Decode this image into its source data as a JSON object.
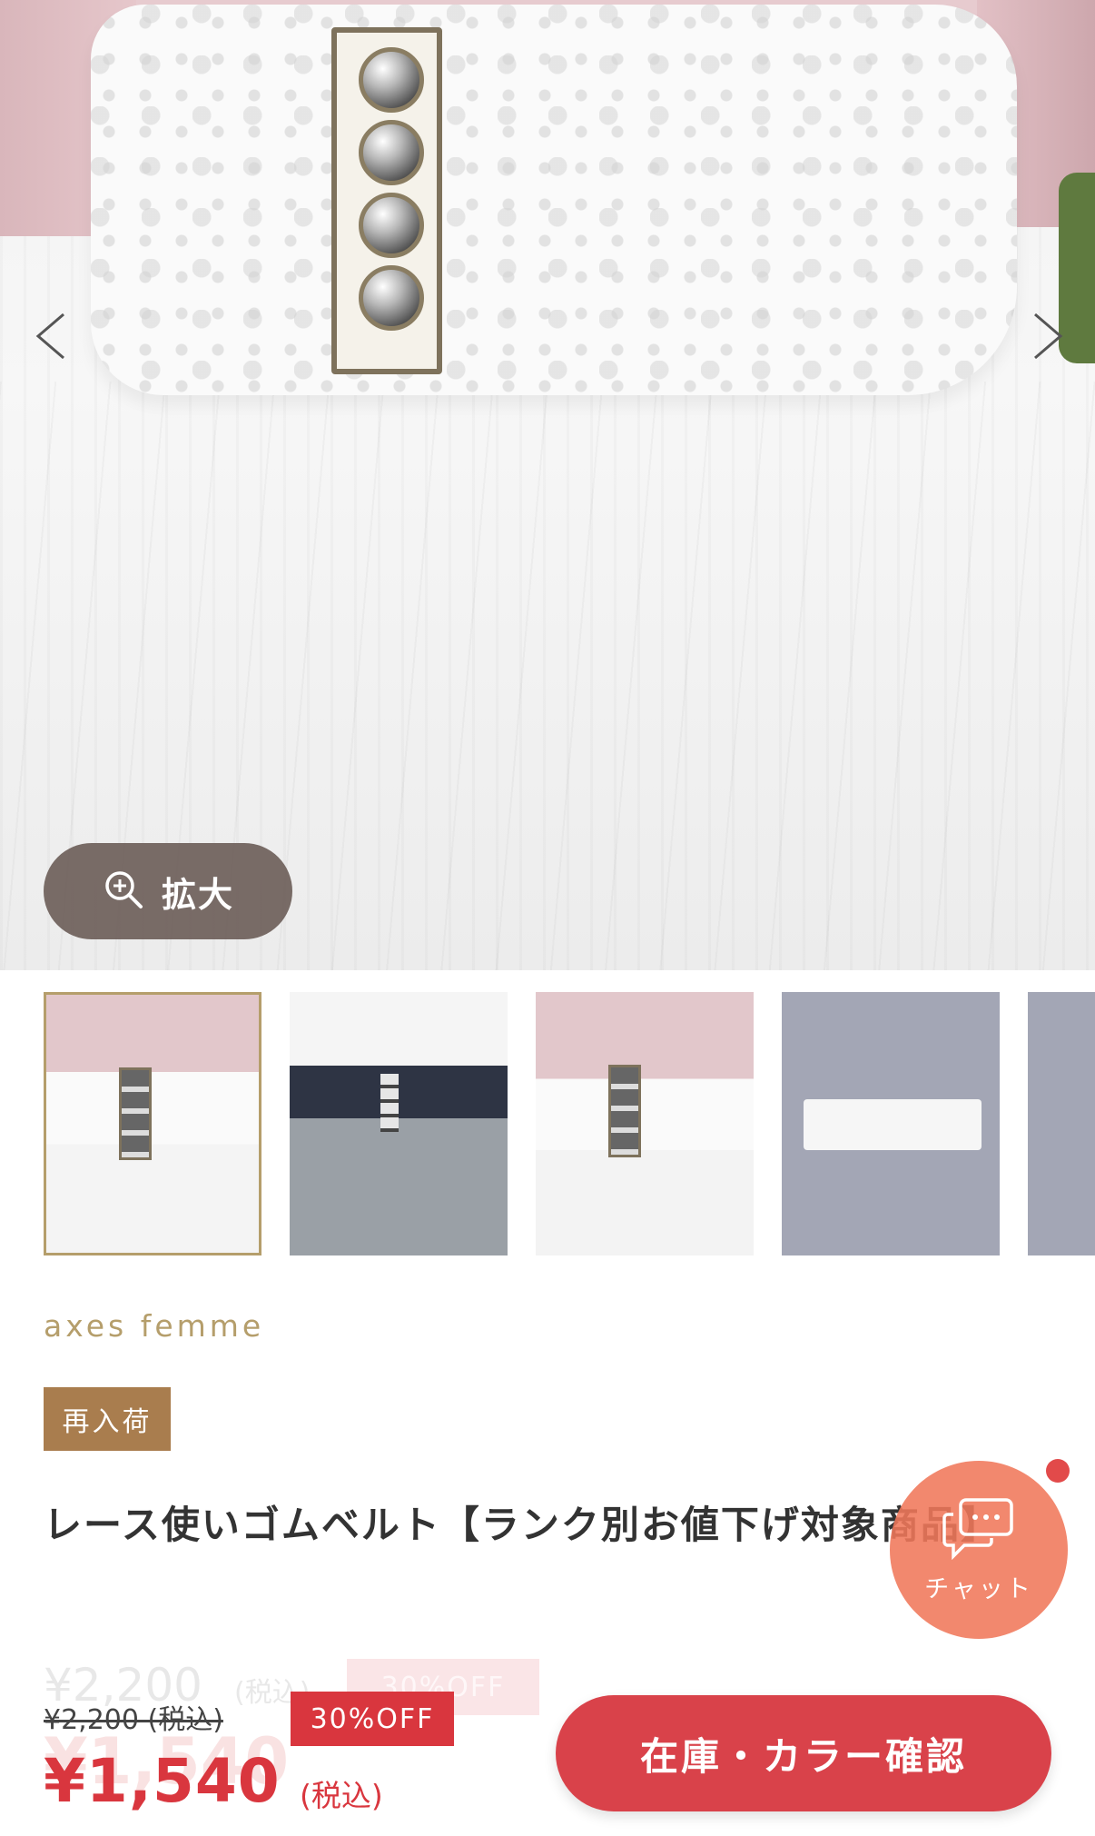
{
  "product_gallery": {
    "zoom_label": "拡大",
    "thumbnails": [
      {
        "icon": "white-lace-belt-pink-top",
        "selected": true
      },
      {
        "icon": "black-lace-belt-check-skirt",
        "selected": false
      },
      {
        "icon": "white-lace-belt-pink-top",
        "selected": false
      },
      {
        "icon": "white-belt-flatlay",
        "selected": false
      },
      {
        "icon": "belt-flatlay-partial",
        "selected": false
      }
    ]
  },
  "product": {
    "brand": "axes femme",
    "badge": "再入荷",
    "title": "レース使いゴムベルト【ランク別お値下げ対象商品】"
  },
  "price": {
    "ghost_old": "¥2,200",
    "ghost_tax": "(税込)",
    "ghost_off": "30%OFF",
    "ghost_new": "¥1,540",
    "old": "¥2,200 (税込)",
    "off": "30%OFF",
    "new": "¥1,540",
    "tax": "(税込)"
  },
  "chat": {
    "label": "チャット"
  },
  "cta": {
    "label": "在庫・カラー確認"
  },
  "colors": {
    "accent_red": "#d9363e",
    "brand_gold": "#b59e6b",
    "badge_brown": "#a97d4e",
    "chat_orange": "#f0785a"
  }
}
